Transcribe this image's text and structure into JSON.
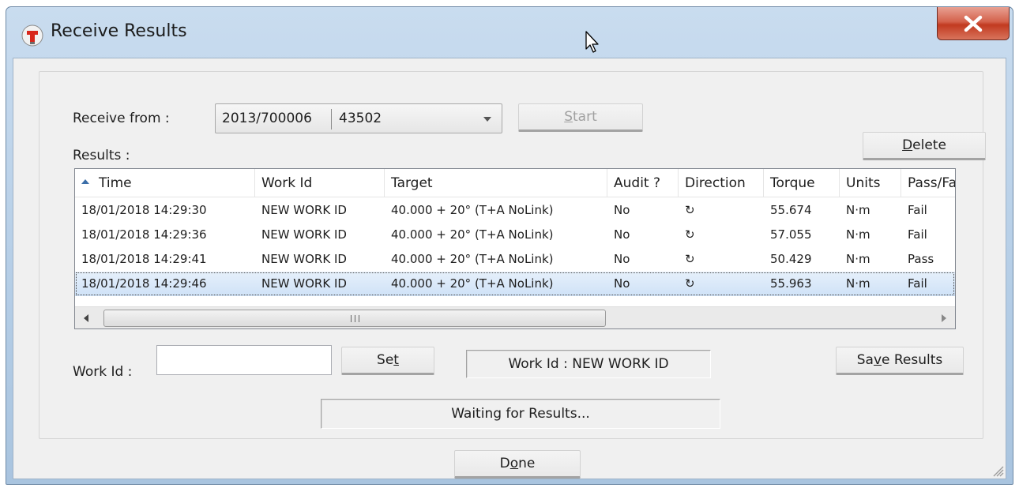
{
  "window": {
    "title": "Receive Results"
  },
  "receive": {
    "label": "Receive from :",
    "combo_part1": "2013/700006",
    "combo_part2": "43502",
    "start_prefix": "",
    "start_accel": "S",
    "start_rest": "tart"
  },
  "results": {
    "label": "Results :"
  },
  "delete_button": {
    "prefix": "",
    "accel": "D",
    "rest": "elete"
  },
  "table": {
    "columns": [
      "Time",
      "Work Id",
      "Target",
      "Audit ?",
      "Direction",
      "Torque",
      "Units",
      "Pass/Fa"
    ],
    "rows": [
      {
        "time": "18/01/2018 14:29:30",
        "work_id": "NEW WORK ID",
        "target": "40.000 + 20° (T+A NoLink)",
        "audit": "No",
        "direction": "↻",
        "torque": "55.674",
        "units": "N·m",
        "pass": "Fail"
      },
      {
        "time": "18/01/2018 14:29:36",
        "work_id": "NEW WORK ID",
        "target": "40.000 + 20° (T+A NoLink)",
        "audit": "No",
        "direction": "↻",
        "torque": "57.055",
        "units": "N·m",
        "pass": "Fail"
      },
      {
        "time": "18/01/2018 14:29:41",
        "work_id": "NEW WORK ID",
        "target": "40.000 + 20° (T+A NoLink)",
        "audit": "No",
        "direction": "↻",
        "torque": "50.429",
        "units": "N·m",
        "pass": "Pass"
      },
      {
        "time": "18/01/2018 14:29:46",
        "work_id": "NEW WORK ID",
        "target": "40.000 + 20° (T+A NoLink)",
        "audit": "No",
        "direction": "↻",
        "torque": "55.963",
        "units": "N·m",
        "pass": "Fail"
      }
    ],
    "selected_row": 3
  },
  "work_id": {
    "label": "Work Id :",
    "value": "",
    "set_prefix": "Se",
    "set_accel": "t",
    "set_rest": "",
    "current_display": "Work Id : NEW WORK ID"
  },
  "save_button": {
    "prefix": "Sa",
    "accel": "v",
    "rest": "e Results"
  },
  "status": {
    "text": "Waiting for Results..."
  },
  "done_button": {
    "prefix": "D",
    "accel": "o",
    "rest": "ne"
  }
}
